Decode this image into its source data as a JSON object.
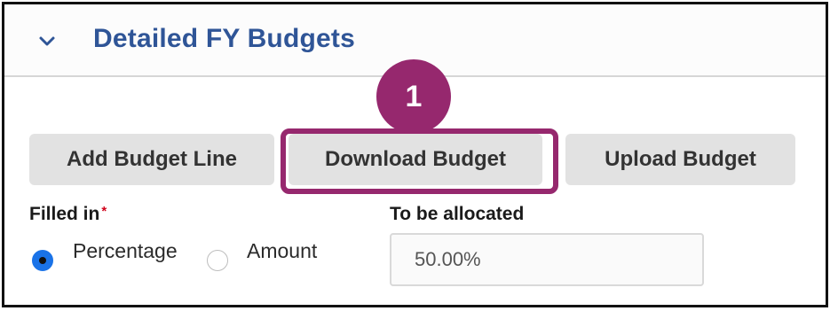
{
  "section": {
    "title": "Detailed FY Budgets",
    "toggle_icon": "chevron-down-icon"
  },
  "annotation": {
    "step_number": "1",
    "color": "#96286e"
  },
  "buttons": {
    "add_label": "Add Budget Line",
    "download_label": "Download Budget",
    "upload_label": "Upload Budget"
  },
  "filled_in": {
    "label": "Filled in",
    "required_mark": "*",
    "options": [
      {
        "label": "Percentage",
        "selected": true
      },
      {
        "label": "Amount",
        "selected": false
      }
    ]
  },
  "allocation": {
    "label": "To be allocated",
    "value": "50.00%"
  },
  "colors": {
    "title": "#2f5597",
    "button_bg": "#e2e2e2",
    "radio_selected": "#1a73e8",
    "required": "#d0021b"
  }
}
